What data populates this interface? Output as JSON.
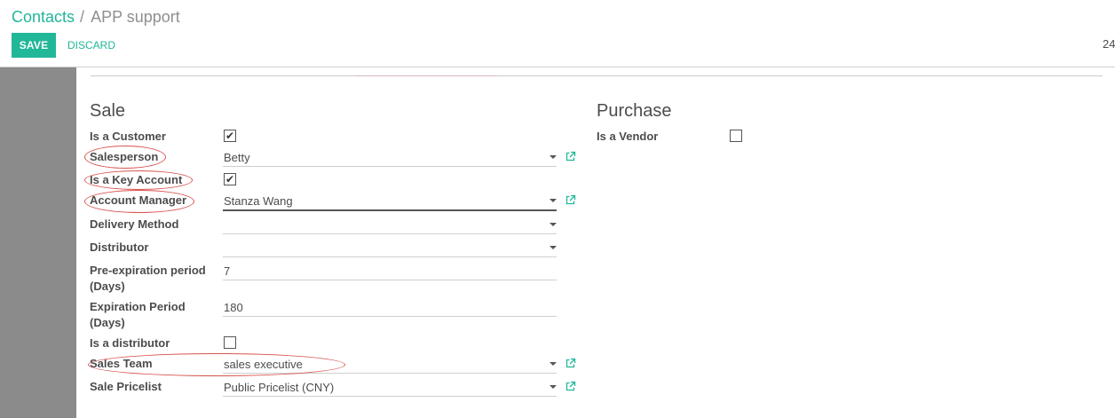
{
  "breadcrumb": {
    "parent": "Contacts",
    "separator": "/",
    "current": "APP support"
  },
  "toolbar": {
    "save_label": "SAVE",
    "discard_label": "DISCARD",
    "pager_text": "24"
  },
  "sale": {
    "title": "Sale",
    "is_customer": {
      "label": "Is a Customer",
      "checked": true
    },
    "salesperson": {
      "label": "Salesperson",
      "value": "Betty"
    },
    "is_key_account": {
      "label": "Is a Key Account",
      "checked": true
    },
    "account_manager": {
      "label": "Account Manager",
      "value": "Stanza Wang"
    },
    "delivery_method": {
      "label": "Delivery Method",
      "value": ""
    },
    "distributor": {
      "label": "Distributor",
      "value": ""
    },
    "pre_expiration": {
      "label": "Pre-expiration period (Days)",
      "value": "7"
    },
    "expiration": {
      "label": "Expiration Period (Days)",
      "value": "180"
    },
    "is_distributor": {
      "label": "Is a distributor",
      "checked": false
    },
    "sales_team": {
      "label": "Sales Team",
      "value": "sales executive"
    },
    "pricelist": {
      "label": "Sale Pricelist",
      "value": "Public Pricelist (CNY)"
    }
  },
  "purchase": {
    "title": "Purchase",
    "is_vendor": {
      "label": "Is a Vendor",
      "checked": false
    }
  },
  "colors": {
    "accent": "#21b799",
    "annotation": "#d9534f",
    "side_panel": "#8b8b8b"
  },
  "icons": {
    "external_link": "external-link-icon",
    "dropdown": "caret-down-icon",
    "check": "checkmark-icon"
  }
}
